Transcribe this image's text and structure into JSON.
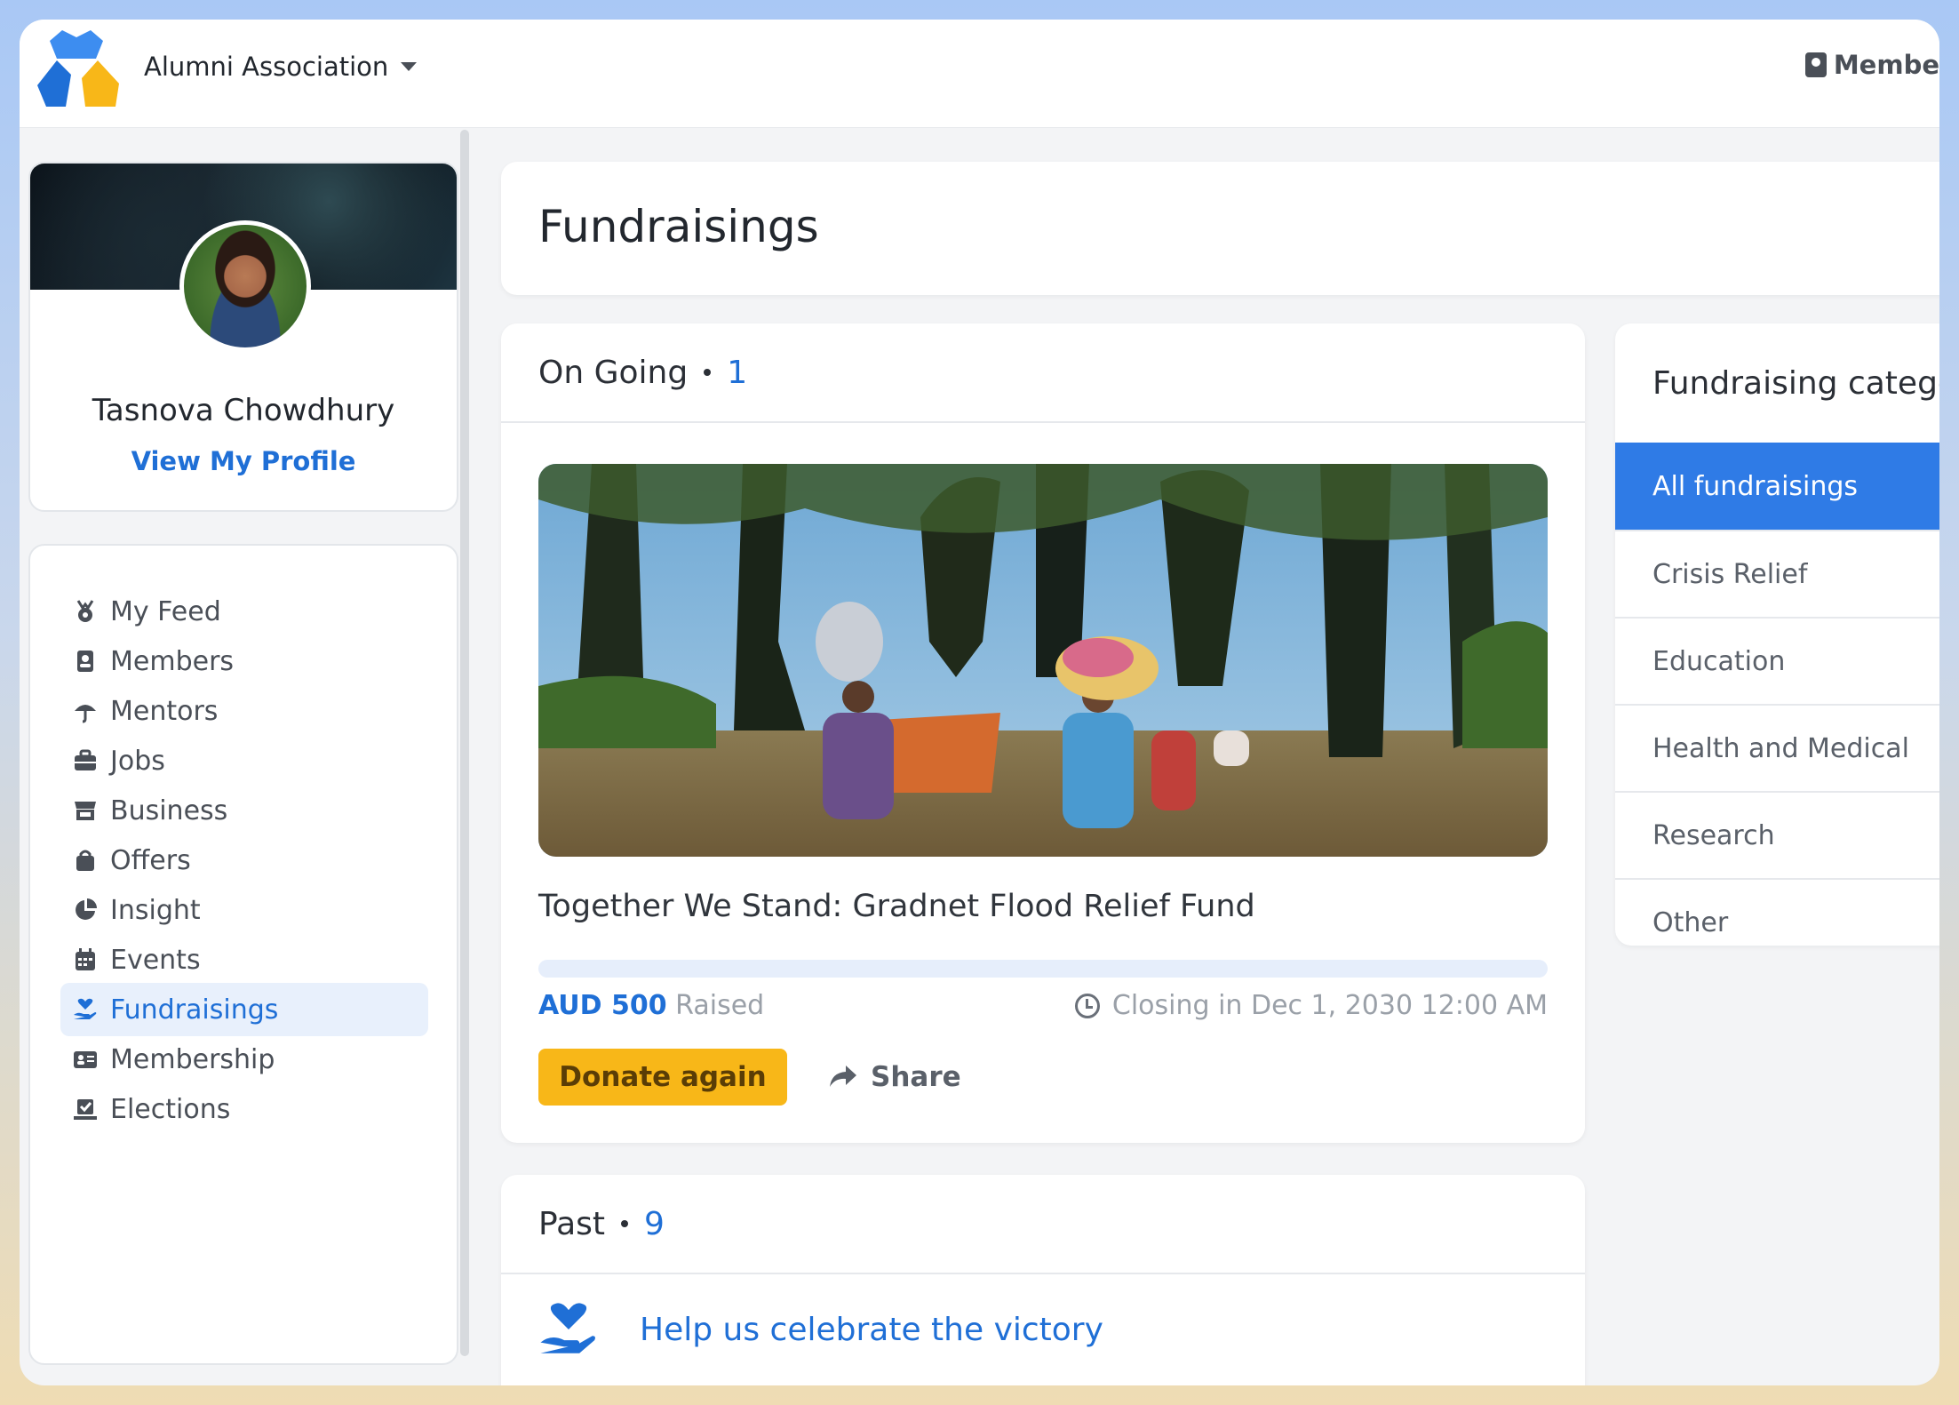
{
  "header": {
    "org_name": "Alumni Association",
    "members_label": "Membe"
  },
  "profile": {
    "name": "Tasnova Chowdhury",
    "view_profile": "View My Profile"
  },
  "nav": {
    "items": [
      {
        "label": "My Feed",
        "icon": "medal-icon"
      },
      {
        "label": "Members",
        "icon": "contact-book-icon"
      },
      {
        "label": "Mentors",
        "icon": "umbrella-icon"
      },
      {
        "label": "Jobs",
        "icon": "briefcase-icon"
      },
      {
        "label": "Business",
        "icon": "store-icon"
      },
      {
        "label": "Offers",
        "icon": "shopping-bag-icon"
      },
      {
        "label": "Insight",
        "icon": "pie-chart-icon"
      },
      {
        "label": "Events",
        "icon": "calendar-icon"
      },
      {
        "label": "Fundraisings",
        "icon": "hand-heart-icon",
        "active": true
      },
      {
        "label": "Membership",
        "icon": "id-card-icon"
      },
      {
        "label": "Elections",
        "icon": "vote-box-icon"
      }
    ]
  },
  "page": {
    "title": "Fundraisings"
  },
  "ongoing": {
    "label": "On Going",
    "count": "1",
    "campaign": {
      "title": "Together We Stand: Gradnet Flood Relief Fund",
      "amount": "AUD 500",
      "raised_label": "Raised",
      "closing": "Closing in Dec 1, 2030 12:00 AM",
      "progress_fraction": 0,
      "donate_label": "Donate again",
      "share_label": "Share"
    }
  },
  "past": {
    "label": "Past",
    "count": "9",
    "first_item": "Help us celebrate the victory"
  },
  "categories": {
    "title": "Fundraising catego",
    "items": [
      {
        "label": "All fundraisings",
        "active": true
      },
      {
        "label": "Crisis Relief"
      },
      {
        "label": "Education"
      },
      {
        "label": "Health and Medical"
      },
      {
        "label": "Research"
      },
      {
        "label": "Other"
      }
    ]
  },
  "colors": {
    "accent": "#1f6fd6",
    "category_active": "#2f7be6",
    "donate": "#f8b718"
  }
}
